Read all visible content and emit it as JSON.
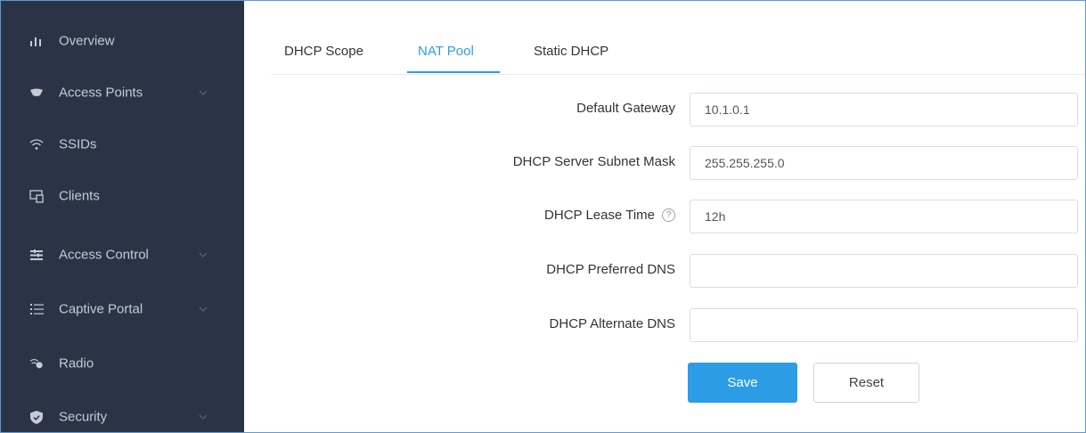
{
  "sidebar": {
    "items": [
      {
        "label": "Overview",
        "icon": "bar-chart-icon",
        "has_submenu": false
      },
      {
        "label": "Access Points",
        "icon": "access-point-icon",
        "has_submenu": true
      },
      {
        "label": "SSIDs",
        "icon": "wifi-icon",
        "has_submenu": false
      },
      {
        "label": "Clients",
        "icon": "clients-icon",
        "has_submenu": false
      },
      {
        "label": "Access Control",
        "icon": "access-control-icon",
        "has_submenu": true
      },
      {
        "label": "Captive Portal",
        "icon": "list-icon",
        "has_submenu": true
      },
      {
        "label": "Radio",
        "icon": "radio-icon",
        "has_submenu": false
      },
      {
        "label": "Security",
        "icon": "shield-icon",
        "has_submenu": true
      }
    ]
  },
  "tabs": [
    {
      "label": "DHCP Scope",
      "active": false
    },
    {
      "label": "NAT Pool",
      "active": true
    },
    {
      "label": "Static DHCP",
      "active": false
    }
  ],
  "form": {
    "default_gateway": {
      "label": "Default Gateway",
      "value": "10.1.0.1"
    },
    "subnet_mask": {
      "label": "DHCP Server Subnet Mask",
      "value": "255.255.255.0"
    },
    "lease_time": {
      "label": "DHCP Lease Time",
      "value": "12h",
      "help": "?"
    },
    "preferred_dns": {
      "label": "DHCP Preferred DNS",
      "value": ""
    },
    "alternate_dns": {
      "label": "DHCP Alternate DNS",
      "value": ""
    }
  },
  "buttons": {
    "save": "Save",
    "reset": "Reset"
  },
  "colors": {
    "sidebar_bg": "#2a3446",
    "accent": "#2d9ce6",
    "sidebar_text": "#c4cbd6"
  }
}
